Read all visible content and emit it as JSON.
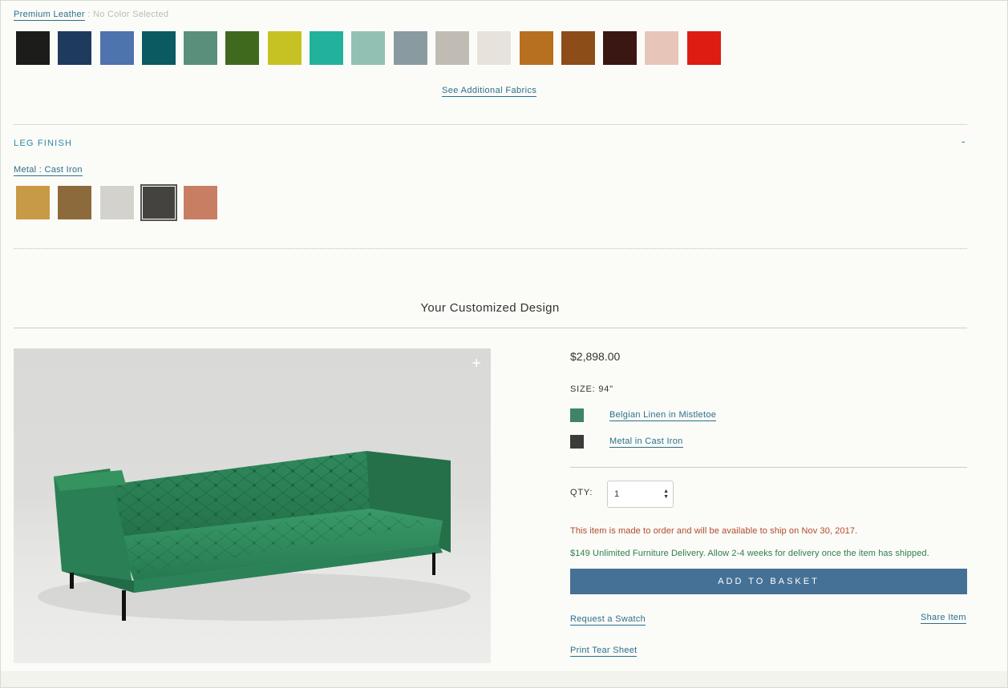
{
  "fabric": {
    "label": "Premium Leather",
    "separator": " : ",
    "status": "No Color Selected",
    "swatches": [
      {
        "name": "black",
        "color": "#1c1c1a"
      },
      {
        "name": "navy",
        "color": "#1e3b5e"
      },
      {
        "name": "periwinkle",
        "color": "#4e73ad"
      },
      {
        "name": "teal",
        "color": "#0c5a61"
      },
      {
        "name": "sage",
        "color": "#5a8f7b"
      },
      {
        "name": "olive",
        "color": "#3f6a1e"
      },
      {
        "name": "chartreuse",
        "color": "#c7c224"
      },
      {
        "name": "turquoise",
        "color": "#22b29b"
      },
      {
        "name": "seafoam",
        "color": "#92c1b3"
      },
      {
        "name": "slate",
        "color": "#8a9aa1"
      },
      {
        "name": "taupe",
        "color": "#c0bcb4"
      },
      {
        "name": "cream",
        "color": "#e7e3dc"
      },
      {
        "name": "cognac",
        "color": "#b6701f"
      },
      {
        "name": "saddle",
        "color": "#8d4d18"
      },
      {
        "name": "oxblood",
        "color": "#3a1712"
      },
      {
        "name": "blush",
        "color": "#e7c5b8"
      },
      {
        "name": "red",
        "color": "#de1c12"
      }
    ],
    "see_more_label": "See Additional Fabrics"
  },
  "leg_finish": {
    "title": "LEG FINISH",
    "toggle": "-",
    "label": "Metal : Cast Iron",
    "swatches": [
      {
        "name": "brass",
        "color": "#c79a45"
      },
      {
        "name": "antique-brass",
        "color": "#8d6a3c"
      },
      {
        "name": "silver",
        "color": "#d3d2cc"
      },
      {
        "name": "cast-iron",
        "color": "#444340",
        "selected": true
      },
      {
        "name": "copper",
        "color": "#c87e63"
      }
    ]
  },
  "summary": {
    "title": "Your Customized Design",
    "price": "$2,898.00",
    "size": "SIZE: 94\"",
    "options": [
      {
        "label": "Belgian Linen in Mistletoe",
        "color": "#3f8466"
      },
      {
        "label": "Metal in Cast Iron",
        "color": "#3c3b39"
      }
    ],
    "qty_label": "QTY:",
    "qty_value": "1",
    "ship_note": "This item is made to order and will be available to ship on Nov 30, 2017.",
    "delivery_note": "$149 Unlimited Furniture Delivery. Allow 2-4 weeks for delivery once the item has shipped.",
    "add_to_basket": "ADD TO BASKET",
    "request_swatch": "Request a Swatch",
    "share_item": "Share Item",
    "print_tear_sheet": "Print Tear Sheet"
  },
  "colors": {
    "link": "#2c6f8c",
    "accent": "#2c86a8",
    "button": "#457196",
    "sofa": "#2f8a5c"
  }
}
